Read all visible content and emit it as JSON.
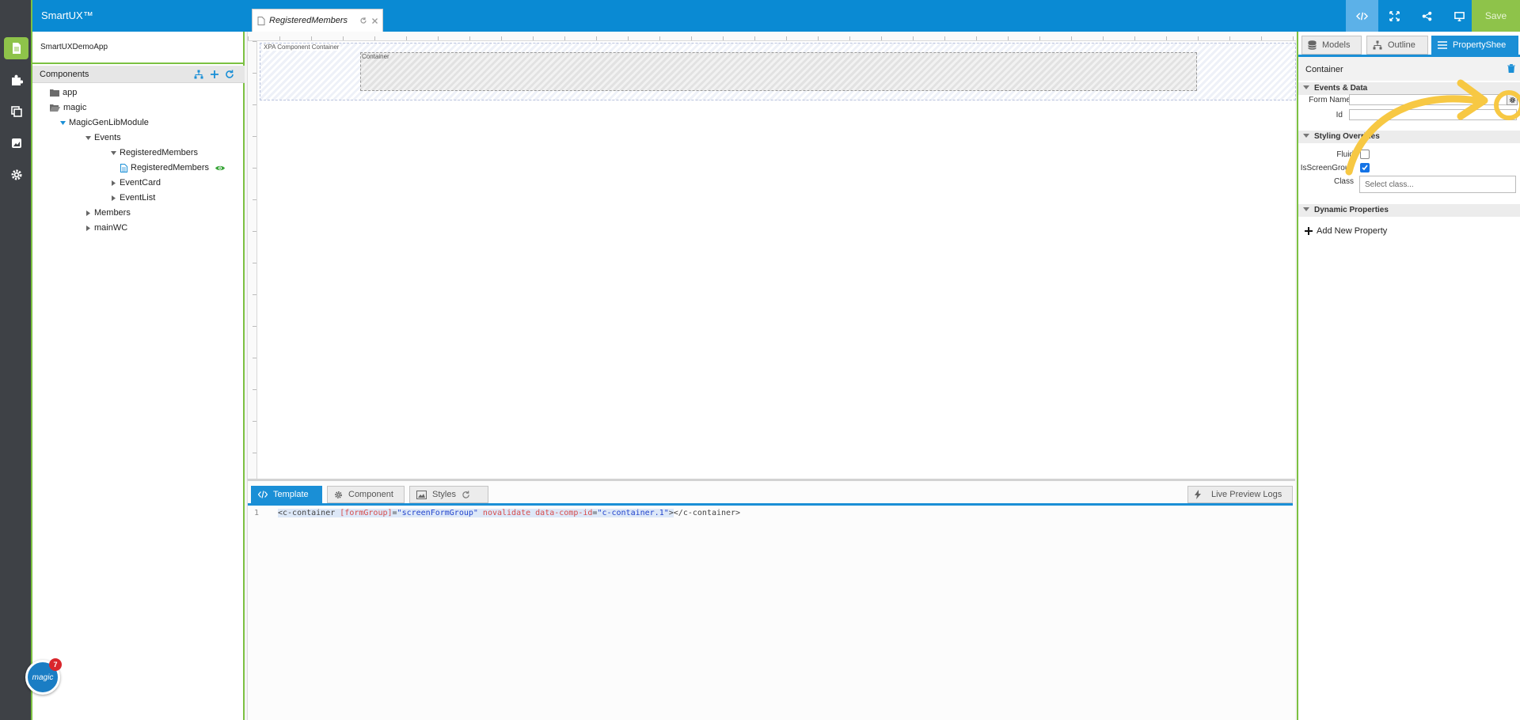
{
  "app": {
    "title": "SmartUX™",
    "save_label": "Save"
  },
  "colors": {
    "accent_blue": "#0a8ad3",
    "accent_green": "#8ec34a",
    "rail_bg": "#3e4146"
  },
  "left_rail": {
    "icons": [
      "document-icon",
      "puzzle-icon",
      "copy-icon",
      "image-icon",
      "gear-icon"
    ]
  },
  "file_tab": {
    "label": "RegisteredMembers"
  },
  "explorer": {
    "project_name": "SmartUXDemoApp",
    "components_title": "Components",
    "tree": [
      {
        "label": "app",
        "type": "folder"
      },
      {
        "label": "magic",
        "type": "folder-open"
      },
      {
        "label": "MagicGenLibModule",
        "type": "module-expanded"
      },
      {
        "label": "Events",
        "type": "expanded"
      },
      {
        "label": "RegisteredMembers",
        "type": "expanded"
      },
      {
        "label": "RegisteredMembers",
        "type": "file",
        "status": "eye-icon"
      },
      {
        "label": "EventCard",
        "type": "collapsed"
      },
      {
        "label": "EventList",
        "type": "collapsed"
      },
      {
        "label": "Members",
        "type": "collapsed"
      },
      {
        "label": "mainWC",
        "type": "collapsed"
      }
    ]
  },
  "canvas": {
    "outer_label": "XPA Component Container",
    "inner_label": "Container"
  },
  "editor": {
    "tabs": [
      "Template",
      "Component",
      "Styles"
    ],
    "logs_label": "Live Preview Logs",
    "code": {
      "line_number": "1",
      "tag_open": "<c-container ",
      "attr1": "[formGroup]",
      "eq1": "=",
      "val1": "\"screenFormGroup\"",
      "attr2": " novalidate data-comp-id",
      "eq2": "=",
      "val2": "\"c-container.1\"",
      "tag_close_a": ">",
      "tag_close_b": "</c-container>"
    }
  },
  "property_panel": {
    "tabs": [
      "Models",
      "Outline",
      "PropertyShee"
    ],
    "title": "Container",
    "sections": {
      "events": "Events & Data",
      "styling": "Styling Overrides",
      "dynamic": "Dynamic Properties"
    },
    "form_name_label": "Form Name",
    "id_label": "Id",
    "fluid_label": "Fluid",
    "fluid_checked": false,
    "is_screen_group_label": "IsScreenGroup",
    "is_screen_group_checked": true,
    "class_label": "Class",
    "class_placeholder": "Select class...",
    "add_property": "Add New Property"
  },
  "notification": {
    "count": "7",
    "badge_label": "magic"
  }
}
